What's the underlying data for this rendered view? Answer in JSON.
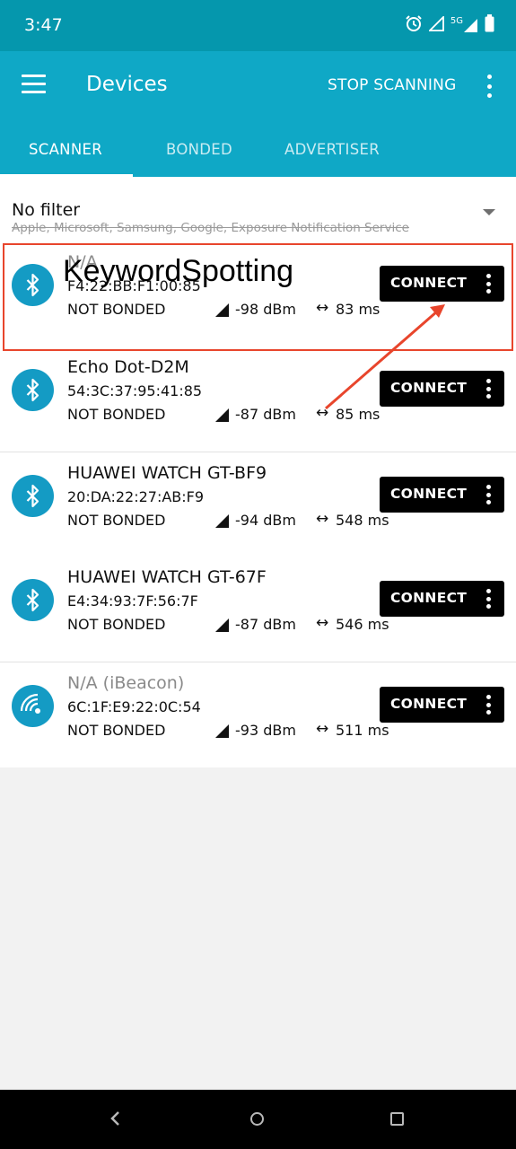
{
  "status_bar": {
    "time": "3:47",
    "network_label": "5G",
    "icons": [
      "alarm-icon",
      "signal-icon",
      "signal-5g-icon",
      "battery-icon"
    ]
  },
  "app_bar": {
    "title": "Devices",
    "action_label": "STOP SCANNING",
    "icons": [
      "menu-icon",
      "more-vert-icon"
    ]
  },
  "tabs": [
    {
      "label": "SCANNER",
      "active": true
    },
    {
      "label": "BONDED",
      "active": false
    },
    {
      "label": "ADVERTISER",
      "active": false
    }
  ],
  "filter": {
    "title": "No filter",
    "subtitle": "Apple, Microsoft, Samsung, Google, Exposure Notification Service"
  },
  "devices": [
    {
      "name": "N/A",
      "mac": "F4:22:BB:F1:00:85",
      "bond_status": "NOT BONDED",
      "rssi": "-98 dBm",
      "interval": "83 ms",
      "icon": "bluetooth-icon",
      "connect_label": "CONNECT"
    },
    {
      "name": "Echo Dot-D2M",
      "mac": "54:3C:37:95:41:85",
      "bond_status": "NOT BONDED",
      "rssi": "-87 dBm",
      "interval": "85 ms",
      "icon": "bluetooth-icon",
      "connect_label": "CONNECT"
    },
    {
      "name": "HUAWEI WATCH GT-BF9",
      "mac": "20:DA:22:27:AB:F9",
      "bond_status": "NOT BONDED",
      "rssi": "-94 dBm",
      "interval": "548 ms",
      "icon": "bluetooth-icon",
      "connect_label": "CONNECT"
    },
    {
      "name": "HUAWEI WATCH GT-67F",
      "mac": "E4:34:93:7F:56:7F",
      "bond_status": "NOT BONDED",
      "rssi": "-87 dBm",
      "interval": "546 ms",
      "icon": "bluetooth-icon",
      "connect_label": "CONNECT"
    },
    {
      "name": "N/A  (iBeacon)",
      "mac": "6C:1F:E9:22:0C:54",
      "bond_status": "NOT BONDED",
      "rssi": "-93 dBm",
      "interval": "511 ms",
      "icon": "beacon-icon",
      "connect_label": "CONNECT"
    }
  ],
  "annotation": {
    "label": "KeywordSpotting",
    "color": "#e8452c"
  },
  "colors": {
    "status_bar": "#0597ad",
    "app_bar": "#0fa8c6",
    "device_avatar": "#149bc4",
    "connect_button": "#000000"
  },
  "nav_bar": {
    "icons": [
      "back-icon",
      "home-icon",
      "recents-icon"
    ]
  }
}
